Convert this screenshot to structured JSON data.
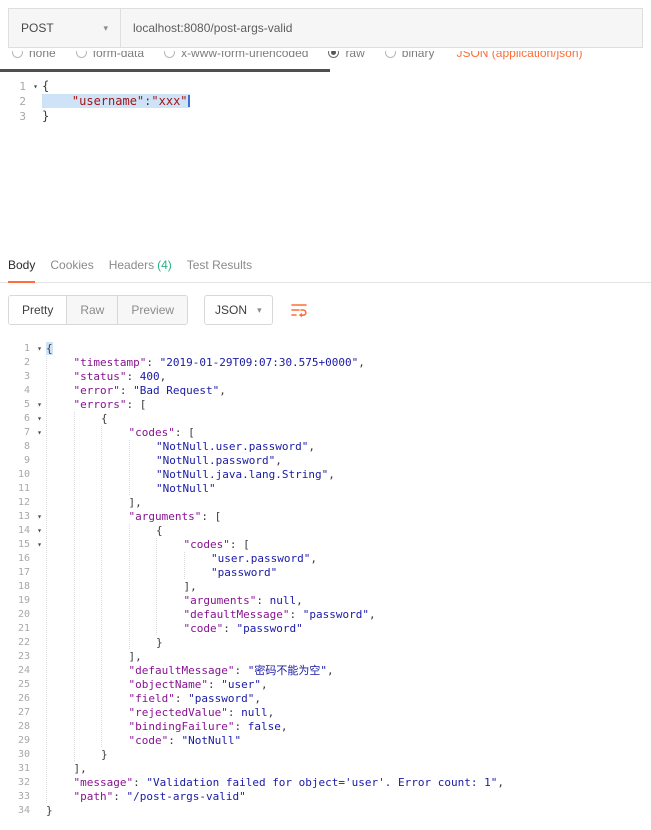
{
  "request_bar": {
    "method": "POST",
    "url": "localhost:8080/post-args-valid"
  },
  "body_type": {
    "options": [
      {
        "label": "none",
        "selected": false
      },
      {
        "label": "form-data",
        "selected": false
      },
      {
        "label": "x-www-form-urlencoded",
        "selected": false
      },
      {
        "label": "raw",
        "selected": true
      },
      {
        "label": "binary",
        "selected": false
      }
    ],
    "content_type": "JSON (application/json)"
  },
  "request_editor": {
    "active_line": 2,
    "lines": [
      "{",
      "    \"username\":\"xxx\"",
      "}"
    ]
  },
  "response_tabs": {
    "tabs": [
      {
        "label": "Body",
        "active": true
      },
      {
        "label": "Cookies",
        "active": false
      },
      {
        "label": "Headers",
        "count": "(4)",
        "active": false
      },
      {
        "label": "Test Results",
        "active": false
      }
    ]
  },
  "response_toolbar": {
    "views": [
      "Pretty",
      "Raw",
      "Preview"
    ],
    "active_view": "Pretty",
    "format": "JSON"
  },
  "response_editor": {
    "active_line": 1,
    "lines": [
      "{",
      "    \"timestamp\": \"2019-01-29T09:07:30.575+0000\",",
      "    \"status\": 400,",
      "    \"error\": \"Bad Request\",",
      "    \"errors\": [",
      "        {",
      "            \"codes\": [",
      "                \"NotNull.user.password\",",
      "                \"NotNull.password\",",
      "                \"NotNull.java.lang.String\",",
      "                \"NotNull\"",
      "            ],",
      "            \"arguments\": [",
      "                {",
      "                    \"codes\": [",
      "                        \"user.password\",",
      "                        \"password\"",
      "                    ],",
      "                    \"arguments\": null,",
      "                    \"defaultMessage\": \"password\",",
      "                    \"code\": \"password\"",
      "                }",
      "            ],",
      "            \"defaultMessage\": \"密码不能为空\",",
      "            \"objectName\": \"user\",",
      "            \"field\": \"password\",",
      "            \"rejectedValue\": null,",
      "            \"bindingFailure\": false,",
      "            \"code\": \"NotNull\"",
      "        }",
      "    ],",
      "    \"message\": \"Validation failed for object='user'. Error count: 1\",",
      "    \"path\": \"/post-args-valid\"",
      "}"
    ]
  },
  "colors": {
    "accent": "#ff6c37",
    "count_green": "#26b47f",
    "selection": "#cfe3f8",
    "caret": "#3b6fd4",
    "token_key": "#881391",
    "token_string": "#1a1aa6",
    "token_number": "#1a1aa6",
    "token_keyword": "#1a1aa6",
    "request_string": "#a31515"
  }
}
